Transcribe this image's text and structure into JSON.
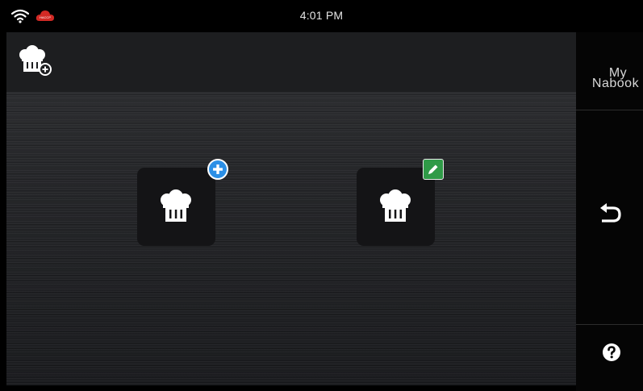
{
  "status_bar": {
    "time": "4:01 PM",
    "wifi_icon": "wifi-icon",
    "cloud_icon": "haccp-cloud-icon",
    "cloud_label": "HACCP",
    "cloud_color": "#d22a25"
  },
  "toolbar": {
    "add_profile_icon": "chef-hat-add-icon"
  },
  "tiles": [
    {
      "name": "add-chef-profile",
      "icon": "chef-hat-icon",
      "badge": "plus-icon",
      "badge_color": "#2b8fe6"
    },
    {
      "name": "edit-chef-profile",
      "icon": "chef-hat-icon",
      "badge": "pencil-icon",
      "badge_color": "#2f9a47"
    }
  ],
  "sidebar": {
    "logo_line1": "My",
    "logo_line2": "Nabook",
    "back_icon": "back-arrow-icon",
    "help_icon": "help-icon"
  },
  "colors": {
    "background": "#000000",
    "panel": "#26272a",
    "tile": "#141416",
    "accent_blue": "#2b8fe6",
    "accent_green": "#2f9a47"
  }
}
